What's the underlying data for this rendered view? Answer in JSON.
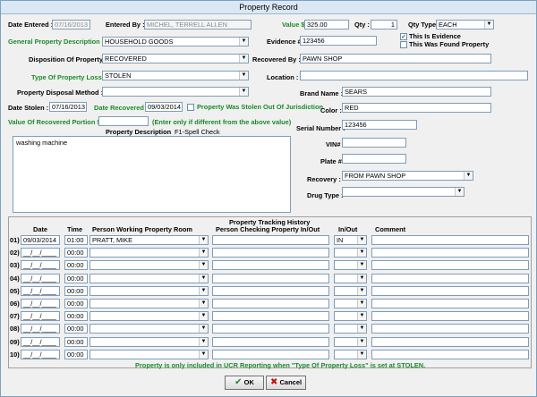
{
  "window": {
    "title": "Property Record"
  },
  "labels": {
    "date_entered": "Date Entered :",
    "entered_by": "Entered By :",
    "value": "Value $",
    "qty": "Qty :",
    "qty_type": "Qty Type :",
    "general_description": "General Property Description :",
    "evidence": "Evidence #",
    "this_is_evidence": "This Is Evidence",
    "this_was_found": "This Was Found Property",
    "disposition": "Disposition Of Property :",
    "recovered_by": "Recovered By :",
    "type_of_loss": "Type Of Property Loss :",
    "location": "Location :",
    "disposal_method": "Property Disposal Method :",
    "brand_name": "Brand Name :",
    "date_stolen": "Date Stolen :",
    "date_recovered": "Date Recovered :",
    "stolen_out_of_jurisdiction": "Property Was Stolen Out Of Jurisdiction",
    "color": "Color :",
    "value_recovered_portion": "Value Of Recovered Portion $",
    "enter_only_if": "(Enter only if different from the above value)",
    "property_description": "Property Description",
    "spell_check": "F1-Spell Check",
    "serial_number": "Serial Number :",
    "vin": "VIN#",
    "plate": "Plate #",
    "recovery": "Recovery :",
    "drug_type": "Drug Type :"
  },
  "values": {
    "date_entered": "07/16/2013",
    "entered_by": "MICHEL, TERRELL ALLEN",
    "value": "325.00",
    "qty": "1",
    "qty_type": "EACH",
    "general_description": "HOUSEHOLD GOODS",
    "evidence": "123456",
    "this_is_evidence_mark": "✓",
    "disposition": "RECOVERED",
    "recovered_by": "PAWN SHOP",
    "type_of_loss": "STOLEN",
    "location": "",
    "disposal_method": "",
    "brand_name": "SEARS",
    "date_stolen": "07/16/2013",
    "date_recovered": "09/03/2014",
    "color": "RED",
    "value_recovered_portion": "",
    "description_text": "washing machine",
    "serial_number": "123456",
    "vin": "",
    "plate": "",
    "recovery": "FROM PAWN SHOP",
    "drug_type": ""
  },
  "tracking": {
    "title": "Property Tracking History",
    "columns": {
      "date": "Date",
      "time": "Time",
      "working": "Person Working Property Room",
      "checking": "Person Checking Property In/Out",
      "inout": "In/Out",
      "comment": "Comment"
    },
    "rows": [
      {
        "num": "01)",
        "date": "09/03/2014",
        "time": "01:00",
        "working": "PRATT, MIKE",
        "checking": "",
        "inout": "IN",
        "comment": ""
      },
      {
        "num": "02)",
        "date": "__/__/____",
        "time": "00:00",
        "working": "",
        "checking": "",
        "inout": "",
        "comment": ""
      },
      {
        "num": "03)",
        "date": "__/__/____",
        "time": "00:00",
        "working": "",
        "checking": "",
        "inout": "",
        "comment": ""
      },
      {
        "num": "04)",
        "date": "__/__/____",
        "time": "00:00",
        "working": "",
        "checking": "",
        "inout": "",
        "comment": ""
      },
      {
        "num": "05)",
        "date": "__/__/____",
        "time": "00:00",
        "working": "",
        "checking": "",
        "inout": "",
        "comment": ""
      },
      {
        "num": "06)",
        "date": "__/__/____",
        "time": "00:00",
        "working": "",
        "checking": "",
        "inout": "",
        "comment": ""
      },
      {
        "num": "07)",
        "date": "__/__/____",
        "time": "00:00",
        "working": "",
        "checking": "",
        "inout": "",
        "comment": ""
      },
      {
        "num": "08)",
        "date": "__/__/____",
        "time": "00:00",
        "working": "",
        "checking": "",
        "inout": "",
        "comment": ""
      },
      {
        "num": "09)",
        "date": "__/__/____",
        "time": "00:00",
        "working": "",
        "checking": "",
        "inout": "",
        "comment": ""
      },
      {
        "num": "10)",
        "date": "__/__/____",
        "time": "00:00",
        "working": "",
        "checking": "",
        "inout": "",
        "comment": ""
      }
    ]
  },
  "footer_note": "Property is only included in UCR Reporting when \"Type Of Property Loss\" is set at STOLEN.",
  "buttons": {
    "ok": "OK",
    "cancel": "Cancel"
  },
  "colors": {
    "green_label": "#1a8a2a",
    "ok_check": "#1a8a2a",
    "cancel_x": "#c01010"
  }
}
